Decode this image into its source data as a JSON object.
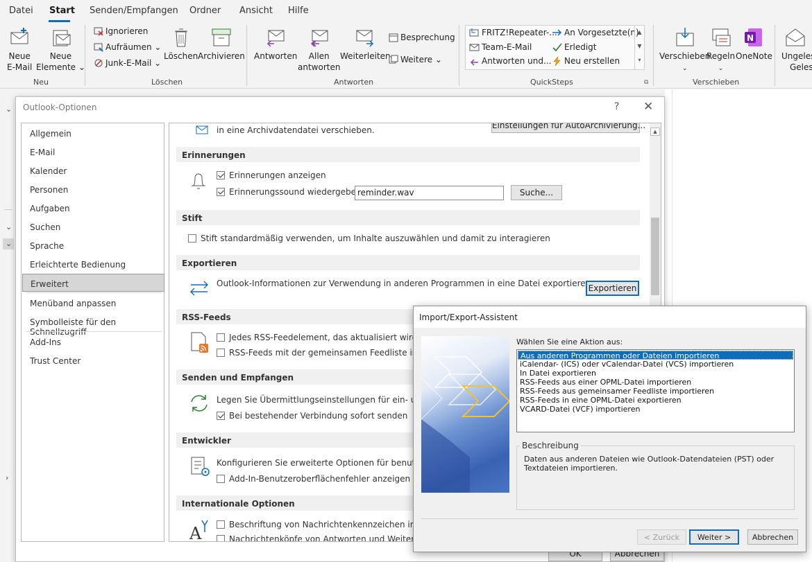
{
  "ribbon": {
    "tabs": [
      "Datei",
      "Start",
      "Senden/Empfangen",
      "Ordner",
      "Ansicht",
      "Hilfe"
    ],
    "new_email": [
      "Neue",
      "E-Mail"
    ],
    "new_items": [
      "Neue",
      "Elemente ⌄"
    ],
    "ignore": "Ignorieren",
    "cleanup": "Aufräumen ⌄",
    "junk": "Junk-E-Mail ⌄",
    "delete": "Löschen",
    "archive": "Archivieren",
    "reply": "Antworten",
    "reply_all": [
      "Allen",
      "antworten"
    ],
    "forward": "Weiterleiten",
    "meeting": "Besprechung",
    "more": "Weitere ⌄",
    "quicksteps": [
      "FRITZ!Repeater-...",
      "Team-E-Mail",
      "Antworten und...",
      "An Vorgesetzte(n)",
      "Erledigt",
      "Neu erstellen"
    ],
    "move": "Verschieben",
    "rules": "Regeln",
    "onenote": "OneNote",
    "unread": [
      "Ungeles",
      "Geles"
    ],
    "groups": [
      "Neu",
      "Löschen",
      "Antworten",
      "QuickSteps",
      "Verschieben"
    ]
  },
  "options": {
    "title": "Outlook-Optionen",
    "help": "?",
    "close": "✕",
    "nav": [
      "Allgemein",
      "E-Mail",
      "Kalender",
      "Personen",
      "Aufgaben",
      "Suchen",
      "Sprache",
      "Erleichterte Bedienung",
      "Erweitert",
      "Menüband anpassen",
      "Symbolleiste für den Schnellzugriff",
      "Add-Ins",
      "Trust Center"
    ],
    "archive_text": "in eine Archivdatendatei verschieben.",
    "archive_button": "Einstellungen für AutoArchivierung...",
    "sections": {
      "reminders": "Erinnerungen",
      "pen": "Stift",
      "export": "Exportieren",
      "rss": "RSS-Feeds",
      "send_receive": "Senden und Empfangen",
      "developer": "Entwickler",
      "international": "Internationale Optionen"
    },
    "show_reminders": "Erinnerungen anzeigen",
    "play_sound": "Erinnerungssound wiedergeben:",
    "sound_file": "reminder.wav",
    "browse": "Suche...",
    "pen_text": "Stift standardmäßig verwenden, um Inhalte auszuwählen und damit zu interagieren",
    "export_text": "Outlook-Informationen zur Verwendung in anderen Programmen in eine Datei exportieren.",
    "export_button": "Exportieren",
    "rss_1": "Jedes RSS-Feedelement, das aktualisiert wird, als ne",
    "rss_2": "RSS-Feeds mit der gemeinsamen Feedliste in Wind",
    "send_text": "Legen Sie Übermittlungseinstellungen für ein- und aus",
    "send_now": "Bei bestehender Verbindung sofort senden",
    "dev_text": "Konfigurieren Sie erweiterte Optionen für benutzerdefi",
    "dev_errors": "Add-In-Benutzeroberflächenfehler anzeigen",
    "intl_1": "Beschriftung von Nachrichtenkennzeichen in Engli",
    "intl_2": "Nachrichtenköpfe von Antworten und Weiterleitun",
    "ok": "OK",
    "cancel": "Abbrechen"
  },
  "wizard": {
    "title": "Import/Export-Assistent",
    "prompt": "Wählen Sie eine Aktion aus:",
    "actions": [
      "Aus anderen Programmen oder Dateien importieren",
      "iCalendar- (ICS) oder vCalendar-Datei (VCS) importieren",
      "In Datei exportieren",
      "RSS-Feeds aus einer OPML-Datei importieren",
      "RSS-Feeds aus gemeinsamer Feedliste importieren",
      "RSS-Feeds in eine OPML-Datei exportieren",
      "VCARD-Datei (VCF) importieren"
    ],
    "desc_label": "Beschreibung",
    "desc_text": "Daten aus anderen Dateien wie Outlook-Datendateien (PST) oder Textdateien importieren.",
    "back": "< Zurück",
    "next": "Weiter >",
    "cancel": "Abbrechen"
  },
  "colors": {
    "accent": "#0f6cbd",
    "onenote": "#7719aa",
    "rss": "#e8762b"
  }
}
